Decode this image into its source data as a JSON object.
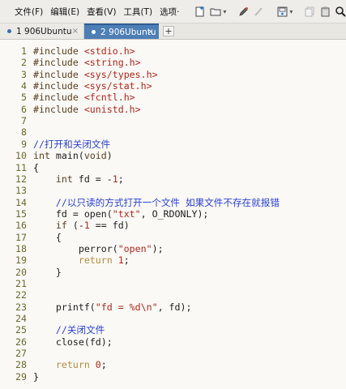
{
  "menubar": {
    "menus": [
      "文件(F)",
      "编辑(E)",
      "查看(V)",
      "工具(T)",
      "选项"
    ],
    "overflow": "·"
  },
  "toolbar": {
    "icons": [
      "new-file-icon",
      "open-folder-icon",
      "edit-pen-icon",
      "clear-icon",
      "save-icon",
      "dropdown-arrow-icon",
      "copy-icon",
      "paste-icon",
      "find-icon",
      "replace-icon"
    ]
  },
  "tabs": [
    {
      "label": "1 906Ubuntu",
      "active": false,
      "close": "×"
    },
    {
      "label": "2 906Ubuntu",
      "active": true,
      "close": "×"
    }
  ],
  "tab_add": "+",
  "code_lines": [
    {
      "n": "1",
      "text": "#include <stdio.h>"
    },
    {
      "n": "2",
      "text": "#include <string.h>"
    },
    {
      "n": "3",
      "text": "#include <sys/types.h>"
    },
    {
      "n": "4",
      "text": "#include <sys/stat.h>"
    },
    {
      "n": "5",
      "text": "#include <fcntl.h>"
    },
    {
      "n": "6",
      "text": "#include <unistd.h>"
    },
    {
      "n": "7",
      "text": ""
    },
    {
      "n": "8",
      "text": ""
    },
    {
      "n": "9",
      "text": "//打开和关闭文件"
    },
    {
      "n": "10",
      "text": "int main(void)"
    },
    {
      "n": "11",
      "text": "{"
    },
    {
      "n": "12",
      "text": "    int fd = -1;"
    },
    {
      "n": "13",
      "text": ""
    },
    {
      "n": "14",
      "text": "    //以只读的方式打开一个文件 如果文件不存在就报错"
    },
    {
      "n": "15",
      "text": "    fd = open(\"txt\", O_RDONLY);"
    },
    {
      "n": "16",
      "text": "    if (-1 == fd)"
    },
    {
      "n": "17",
      "text": "    {"
    },
    {
      "n": "18",
      "text": "        perror(\"open\");"
    },
    {
      "n": "19",
      "text": "        return 1;"
    },
    {
      "n": "20",
      "text": "    }"
    },
    {
      "n": "21",
      "text": ""
    },
    {
      "n": "22",
      "text": ""
    },
    {
      "n": "23",
      "text": "    printf(\"fd = %d\\n\", fd);"
    },
    {
      "n": "24",
      "text": ""
    },
    {
      "n": "25",
      "text": "    //关闭文件"
    },
    {
      "n": "26",
      "text": "    close(fd);"
    },
    {
      "n": "27",
      "text": ""
    },
    {
      "n": "28",
      "text": "    return 0;"
    },
    {
      "n": "29",
      "text": "}"
    }
  ],
  "colors": {
    "active_tab": "#4d7fb6",
    "comment": "#2a3fd4",
    "string": "#b2261a",
    "line_number": "#6a6a2c"
  }
}
